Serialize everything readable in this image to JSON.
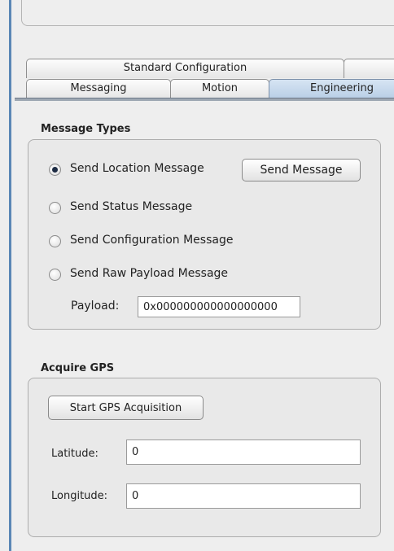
{
  "tabs": {
    "row_back": [
      "Standard Configuration",
      ""
    ],
    "row_front": [
      "Messaging",
      "Motion",
      "Engineering"
    ],
    "active": "Engineering"
  },
  "message_types": {
    "title": "Message Types",
    "options": [
      {
        "label": "Send Location Message",
        "checked": true
      },
      {
        "label": "Send Status Message",
        "checked": false
      },
      {
        "label": "Send Configuration Message",
        "checked": false
      },
      {
        "label": "Send Raw Payload Message",
        "checked": false
      }
    ],
    "send_button": "Send Message",
    "payload_label": "Payload:",
    "payload_value": "0x000000000000000000"
  },
  "acquire_gps": {
    "title": "Acquire GPS",
    "start_button": "Start GPS Acquisition",
    "latitude_label": "Latitude:",
    "latitude_value": "0",
    "longitude_label": "Longitude:",
    "longitude_value": "0"
  }
}
